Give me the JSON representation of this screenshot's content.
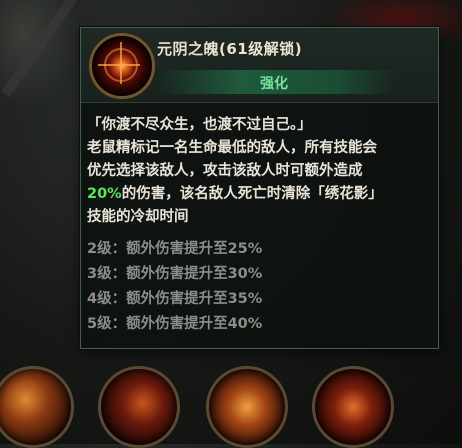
{
  "skill": {
    "name": "元阴之魄",
    "unlock": "(61级解锁)",
    "tag": "强化",
    "icon": "crimson-orb-icon"
  },
  "description": {
    "quote": "「你渡不尽众生，也渡不过自己。」",
    "line1": "老鼠精标记一名生命最低的敌人，所有技能会",
    "line2": "优先选择该敌人，攻击该敌人时可额外造成",
    "highlight": "20%",
    "line3_rest": "的伤害，该名敌人死亡时清除「绣花影」",
    "line4": "技能的冷却时间"
  },
  "levels": [
    "2级：额外伤害提升至25%",
    "3级：额外伤害提升至30%",
    "4级：额外伤害提升至35%",
    "5级：额外伤害提升至40%"
  ],
  "colors": {
    "highlight": "#5fe25d",
    "tag_text": "#77e39a",
    "level_text": "#8b8f8a"
  }
}
